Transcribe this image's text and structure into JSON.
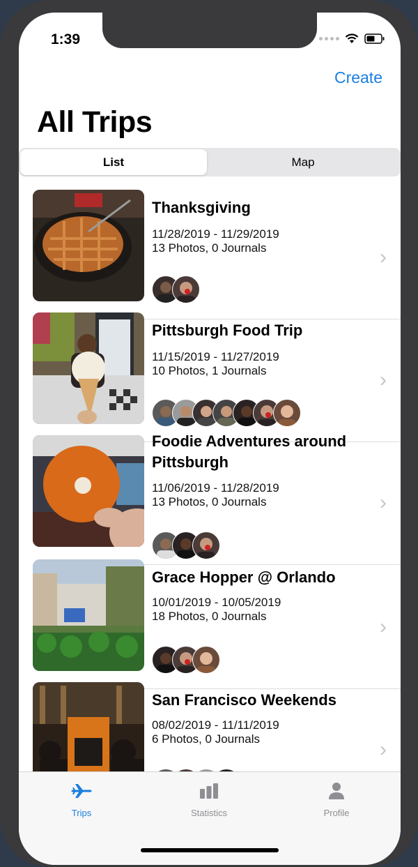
{
  "status": {
    "time": "1:39"
  },
  "header": {
    "create_label": "Create",
    "title": "All Trips"
  },
  "segments": {
    "list": "List",
    "map": "Map"
  },
  "trips": [
    {
      "title": "Thanksgiving",
      "dates": "11/28/2019 - 11/29/2019",
      "counts": "13 Photos, 0 Journals",
      "avatars": 2
    },
    {
      "title": "Pittsburgh Food Trip",
      "dates": "11/15/2019 - 11/27/2019",
      "counts": "10 Photos, 1 Journals",
      "avatars": 7
    },
    {
      "title": "Foodie Adventures around Pittsburgh",
      "dates": "11/06/2019 - 11/28/2019",
      "counts": "13 Photos, 0 Journals",
      "avatars": 3
    },
    {
      "title": "Grace Hopper @ Orlando",
      "dates": "10/01/2019 - 10/05/2019",
      "counts": "18 Photos, 0 Journals",
      "avatars": 3
    },
    {
      "title": "San Francisco Weekends",
      "dates": "08/02/2019 - 11/11/2019",
      "counts": "6 Photos, 0 Journals",
      "avatars": 4
    }
  ],
  "tabs": {
    "trips": "Trips",
    "statistics": "Statistics",
    "profile": "Profile"
  },
  "colors": {
    "accent": "#1a7fe0",
    "inactive": "#8e8e93"
  }
}
